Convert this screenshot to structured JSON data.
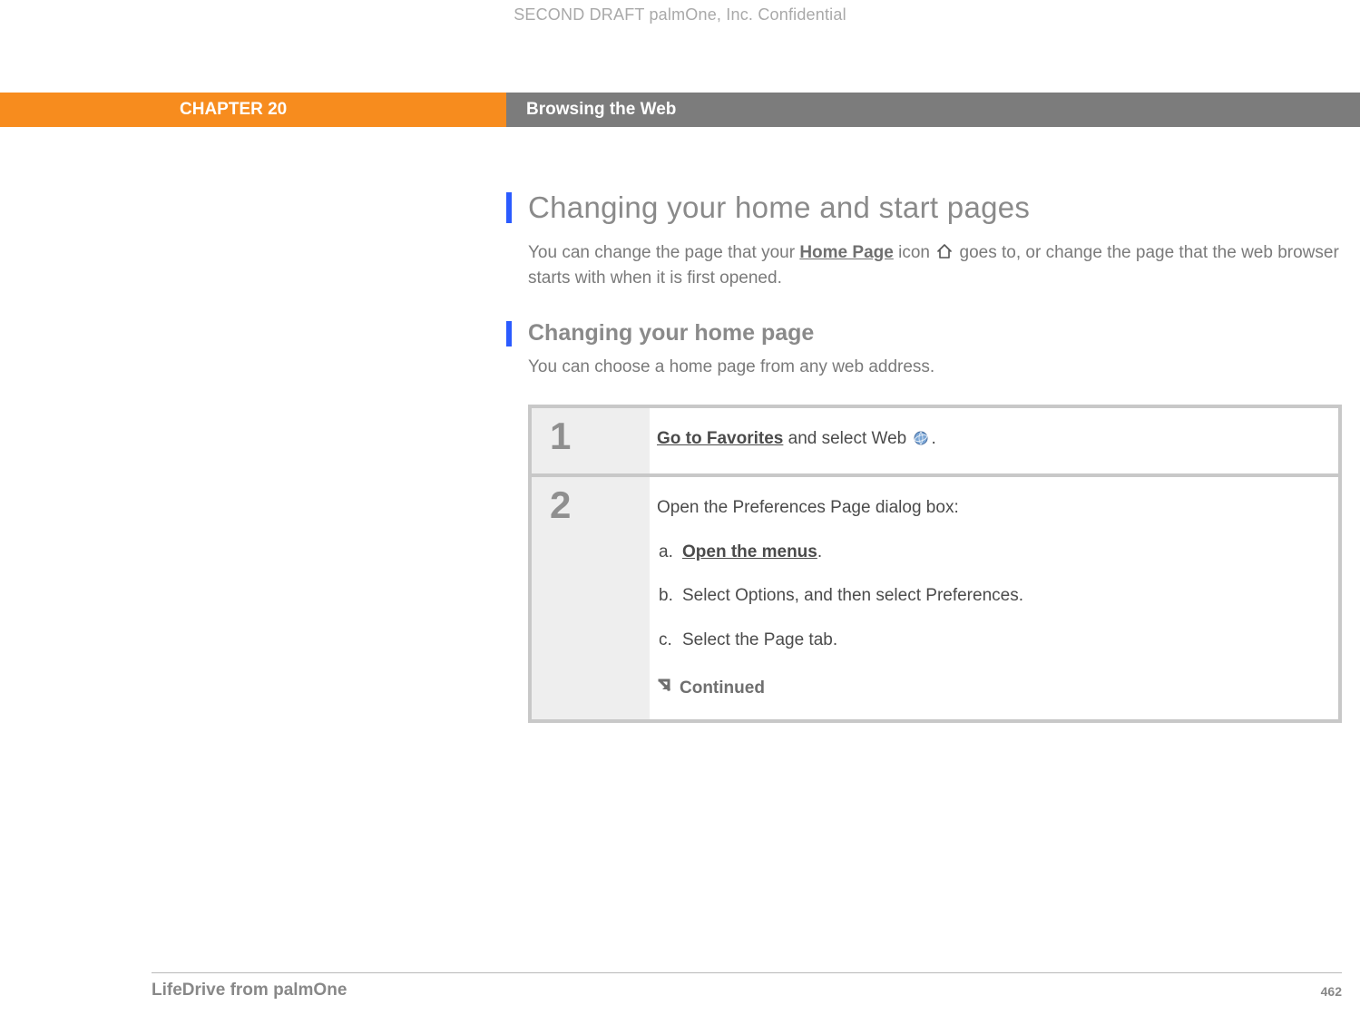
{
  "confidential": "SECOND DRAFT palmOne, Inc.  Confidential",
  "header": {
    "chapter": "CHAPTER 20",
    "title": "Browsing the Web"
  },
  "section": {
    "h1": "Changing your home and start pages",
    "intro_pre": "You can change the page that your ",
    "intro_link": "Home Page",
    "intro_mid": " icon ",
    "intro_post": " goes to, or change the page that the web browser starts with when it is first opened.",
    "h2": "Changing your home page",
    "sub_intro": "You can choose a home page from any web address."
  },
  "steps": [
    {
      "num": "1",
      "pre_link": "Go to Favorites",
      "post": " and select Web ",
      "tail": "."
    },
    {
      "num": "2",
      "lead": "Open the Preferences Page dialog box:",
      "a_label": "a.",
      "a_link": "Open the menus",
      "a_tail": ".",
      "b_label": "b.",
      "b_text": "Select Options, and then select Preferences.",
      "c_label": "c.",
      "c_text": "Select the Page tab.",
      "continued": "Continued"
    }
  ],
  "footer": {
    "left": "LifeDrive from palmOne",
    "right": "462"
  }
}
